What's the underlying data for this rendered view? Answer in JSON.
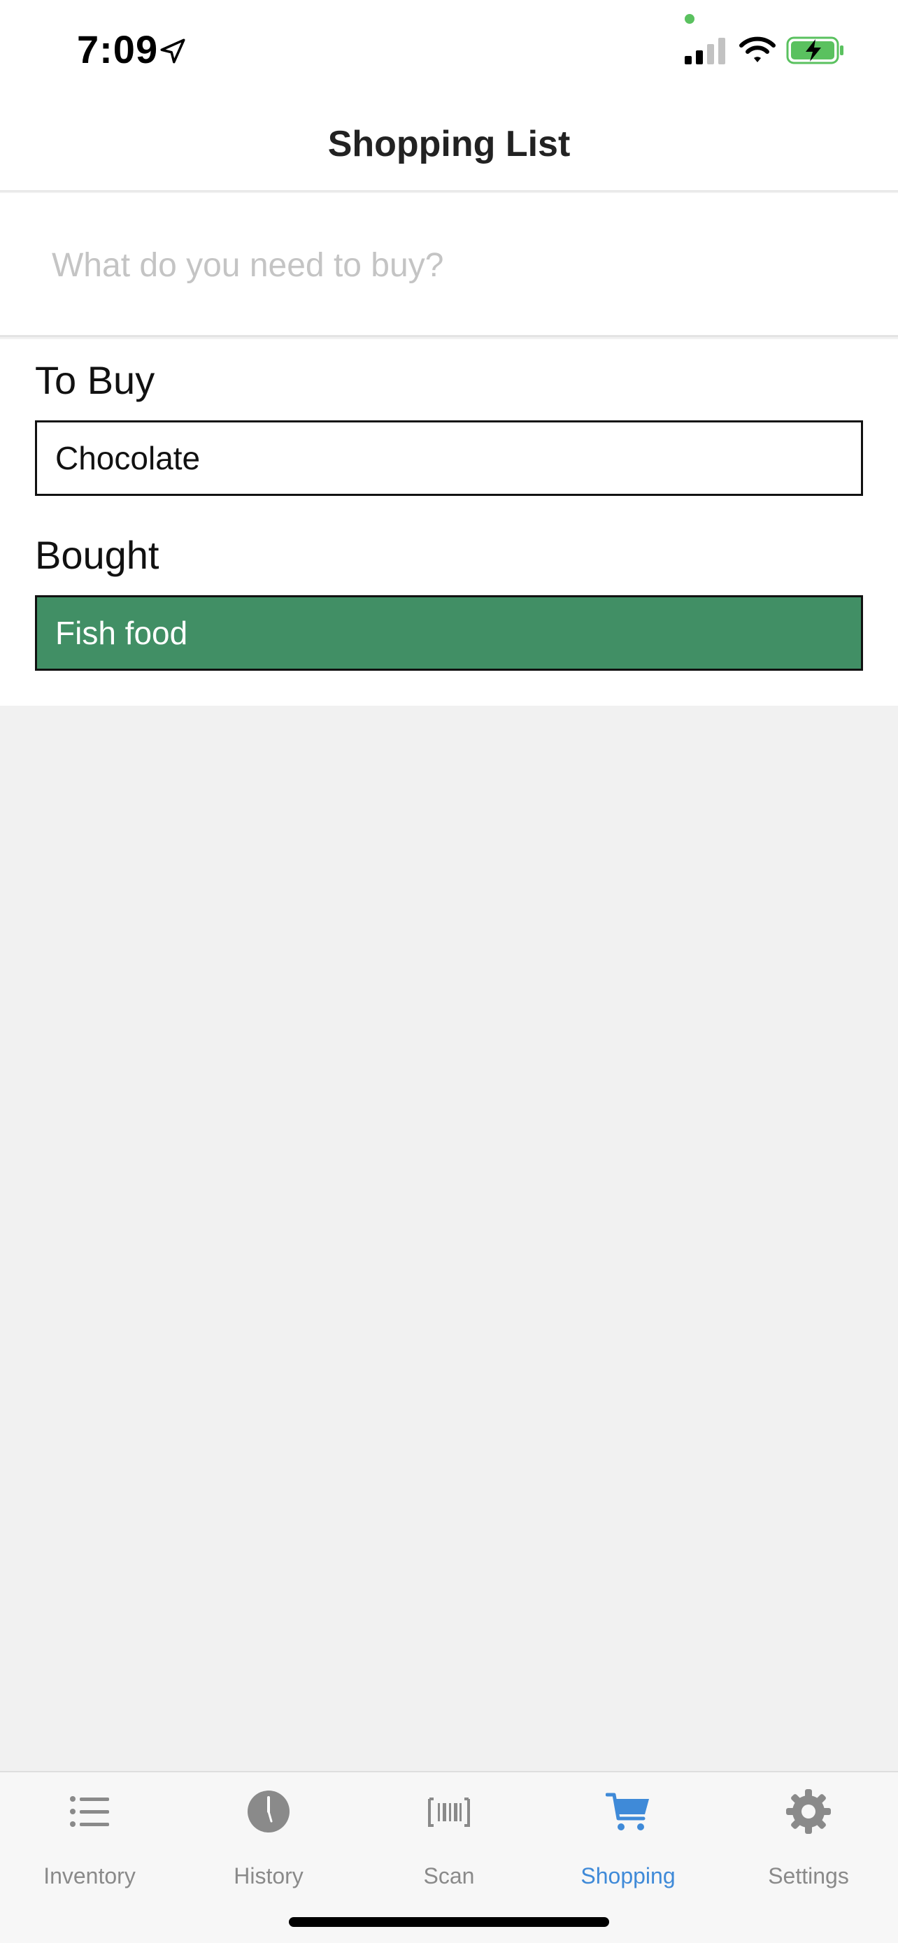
{
  "status_bar": {
    "time": "7:09",
    "icons": [
      "location-arrow-icon",
      "signal-icon",
      "wifi-icon",
      "battery-charging-icon"
    ]
  },
  "header": {
    "title": "Shopping List"
  },
  "add_item": {
    "placeholder": "What do you need to buy?",
    "value": ""
  },
  "sections": {
    "to_buy": {
      "title": "To Buy",
      "items": [
        "Chocolate"
      ]
    },
    "bought": {
      "title": "Bought",
      "items": [
        "Fish food"
      ]
    }
  },
  "colors": {
    "bought_item": "#418f65",
    "tab_active": "#3f8ad8",
    "tab_inactive": "#8a8a8a"
  },
  "tab_bar": {
    "tabs": [
      {
        "label": "Inventory",
        "icon": "list-icon",
        "active": false
      },
      {
        "label": "History",
        "icon": "clock-icon",
        "active": false
      },
      {
        "label": "Scan",
        "icon": "barcode-icon",
        "active": false
      },
      {
        "label": "Shopping",
        "icon": "cart-icon",
        "active": true
      },
      {
        "label": "Settings",
        "icon": "gear-icon",
        "active": false
      }
    ]
  }
}
